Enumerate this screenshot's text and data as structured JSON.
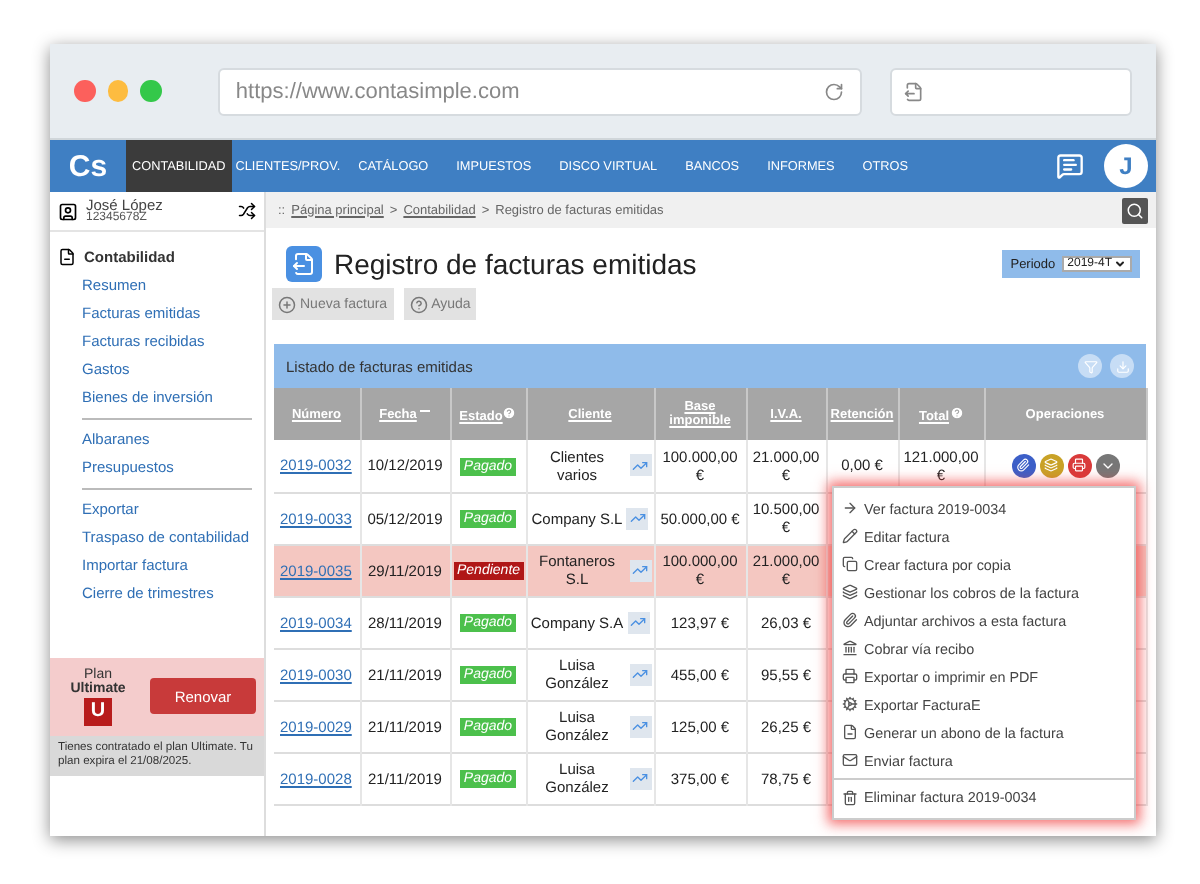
{
  "browser": {
    "url": "https://www.contasimple.com"
  },
  "nav": {
    "logo": "Cs",
    "items": [
      {
        "label": "CONTABILIDAD",
        "selected": true
      },
      {
        "label": "CLIENTES/PROV.",
        "selected": false
      },
      {
        "label": "CATÁLOGO",
        "selected": false
      },
      {
        "label": "IMPUESTOS",
        "selected": false
      },
      {
        "label": "DISCO VIRTUAL",
        "selected": false
      },
      {
        "label": "BANCOS",
        "selected": false
      },
      {
        "label": "INFORMES",
        "selected": false
      },
      {
        "label": "OTROS",
        "selected": false
      }
    ],
    "avatar": "J"
  },
  "user": {
    "name": "José López",
    "id": "12345678Z"
  },
  "breadcrumb": {
    "prefix": "::",
    "separator": ">",
    "links": [
      "Página principal",
      "Contabilidad"
    ],
    "current": "Registro de facturas emitidas"
  },
  "sidebar": {
    "section": "Contabilidad",
    "groups": [
      {
        "items": [
          "Resumen",
          "Facturas emitidas",
          "Facturas recibidas",
          "Gastos",
          "Bienes de inversión"
        ]
      },
      {
        "items": [
          "Albaranes",
          "Presupuestos"
        ]
      },
      {
        "items": [
          "Exportar",
          "Traspaso de contabilidad",
          "Importar factura",
          "Cierre de trimestres"
        ]
      }
    ]
  },
  "plan": {
    "label": "Plan",
    "name": "Ultimate",
    "badge": "U",
    "button": "Renovar",
    "note": "Tienes contratado el plan Ultimate. Tu plan expira el 21/08/2025."
  },
  "page": {
    "title": "Registro de facturas emitidas",
    "period_label": "Periodo",
    "period": "2019-4T",
    "buttons": [
      {
        "label": "Nueva factura",
        "kind": "add"
      },
      {
        "label": "Ayuda",
        "kind": "help"
      }
    ]
  },
  "table": {
    "title": "Listado de facturas emitidas",
    "columns": [
      {
        "label": "Número",
        "sortable": true,
        "sorted": false,
        "help": false
      },
      {
        "label": "Fecha",
        "sortable": true,
        "sorted": true,
        "help": false
      },
      {
        "label": "Estado",
        "sortable": true,
        "sorted": false,
        "help": true
      },
      {
        "label": "Cliente",
        "sortable": true,
        "sorted": false,
        "help": false
      },
      {
        "label": "Base imponible",
        "sortable": true,
        "sorted": false,
        "help": false
      },
      {
        "label": "I.V.A.",
        "sortable": true,
        "sorted": false,
        "help": false
      },
      {
        "label": "Retención",
        "sortable": true,
        "sorted": false,
        "help": false
      },
      {
        "label": "Total",
        "sortable": true,
        "sorted": false,
        "help": true
      },
      {
        "label": "Operaciones",
        "sortable": false,
        "sorted": false,
        "help": false
      }
    ],
    "rows": [
      {
        "number": "2019-0032",
        "date": "10/12/2019",
        "status": {
          "kind": "paid",
          "label": "Pagado"
        },
        "client": "Clientes varios",
        "base": "100.000,00 €",
        "iva": "21.000,00 €",
        "retention": "0,00 €",
        "total": "121.000,00 €",
        "highlighted": false
      },
      {
        "number": "2019-0033",
        "date": "05/12/2019",
        "status": {
          "kind": "paid",
          "label": "Pagado"
        },
        "client": "Company S.L",
        "base": "50.000,00 €",
        "iva": "10.500,00 €",
        "highlighted": false
      },
      {
        "number": "2019-0035",
        "date": "29/11/2019",
        "status": {
          "kind": "pending",
          "label": "Pendiente"
        },
        "client": "Fontaneros S.L",
        "base": "100.000,00 €",
        "iva": "21.000,00 €",
        "highlighted": true
      },
      {
        "number": "2019-0034",
        "date": "28/11/2019",
        "status": {
          "kind": "paid",
          "label": "Pagado"
        },
        "client": "Company S.A",
        "base": "123,97 €",
        "iva": "26,03 €",
        "highlighted": false
      },
      {
        "number": "2019-0030",
        "date": "21/11/2019",
        "status": {
          "kind": "paid",
          "label": "Pagado"
        },
        "client": "Luisa González",
        "base": "455,00 €",
        "iva": "95,55 €",
        "highlighted": false
      },
      {
        "number": "2019-0029",
        "date": "21/11/2019",
        "status": {
          "kind": "paid",
          "label": "Pagado"
        },
        "client": "Luisa González",
        "base": "125,00 €",
        "iva": "26,25 €",
        "highlighted": false
      },
      {
        "number": "2019-0028",
        "date": "21/11/2019",
        "status": {
          "kind": "paid",
          "label": "Pagado"
        },
        "client": "Luisa González",
        "base": "375,00 €",
        "iva": "78,75 €",
        "highlighted": false
      }
    ]
  },
  "menu": {
    "items": [
      {
        "label": "Ver factura 2019-0034",
        "kind": "view"
      },
      {
        "label": "Editar factura",
        "kind": "edit"
      },
      {
        "label": "Crear factura por copia",
        "kind": "copy"
      },
      {
        "label": "Gestionar los cobros de la factura",
        "kind": "payments"
      },
      {
        "label": "Adjuntar archivos a esta factura",
        "kind": "attach"
      },
      {
        "label": "Cobrar vía recibo",
        "kind": "bank"
      },
      {
        "label": "Exportar o imprimir en PDF",
        "kind": "print"
      },
      {
        "label": "Exportar FacturaE",
        "kind": "export"
      },
      {
        "label": "Generar un abono de la factura",
        "kind": "credit"
      },
      {
        "label": "Enviar factura",
        "kind": "send"
      },
      {
        "label": "Eliminar factura 2019-0034",
        "kind": "delete"
      }
    ]
  }
}
